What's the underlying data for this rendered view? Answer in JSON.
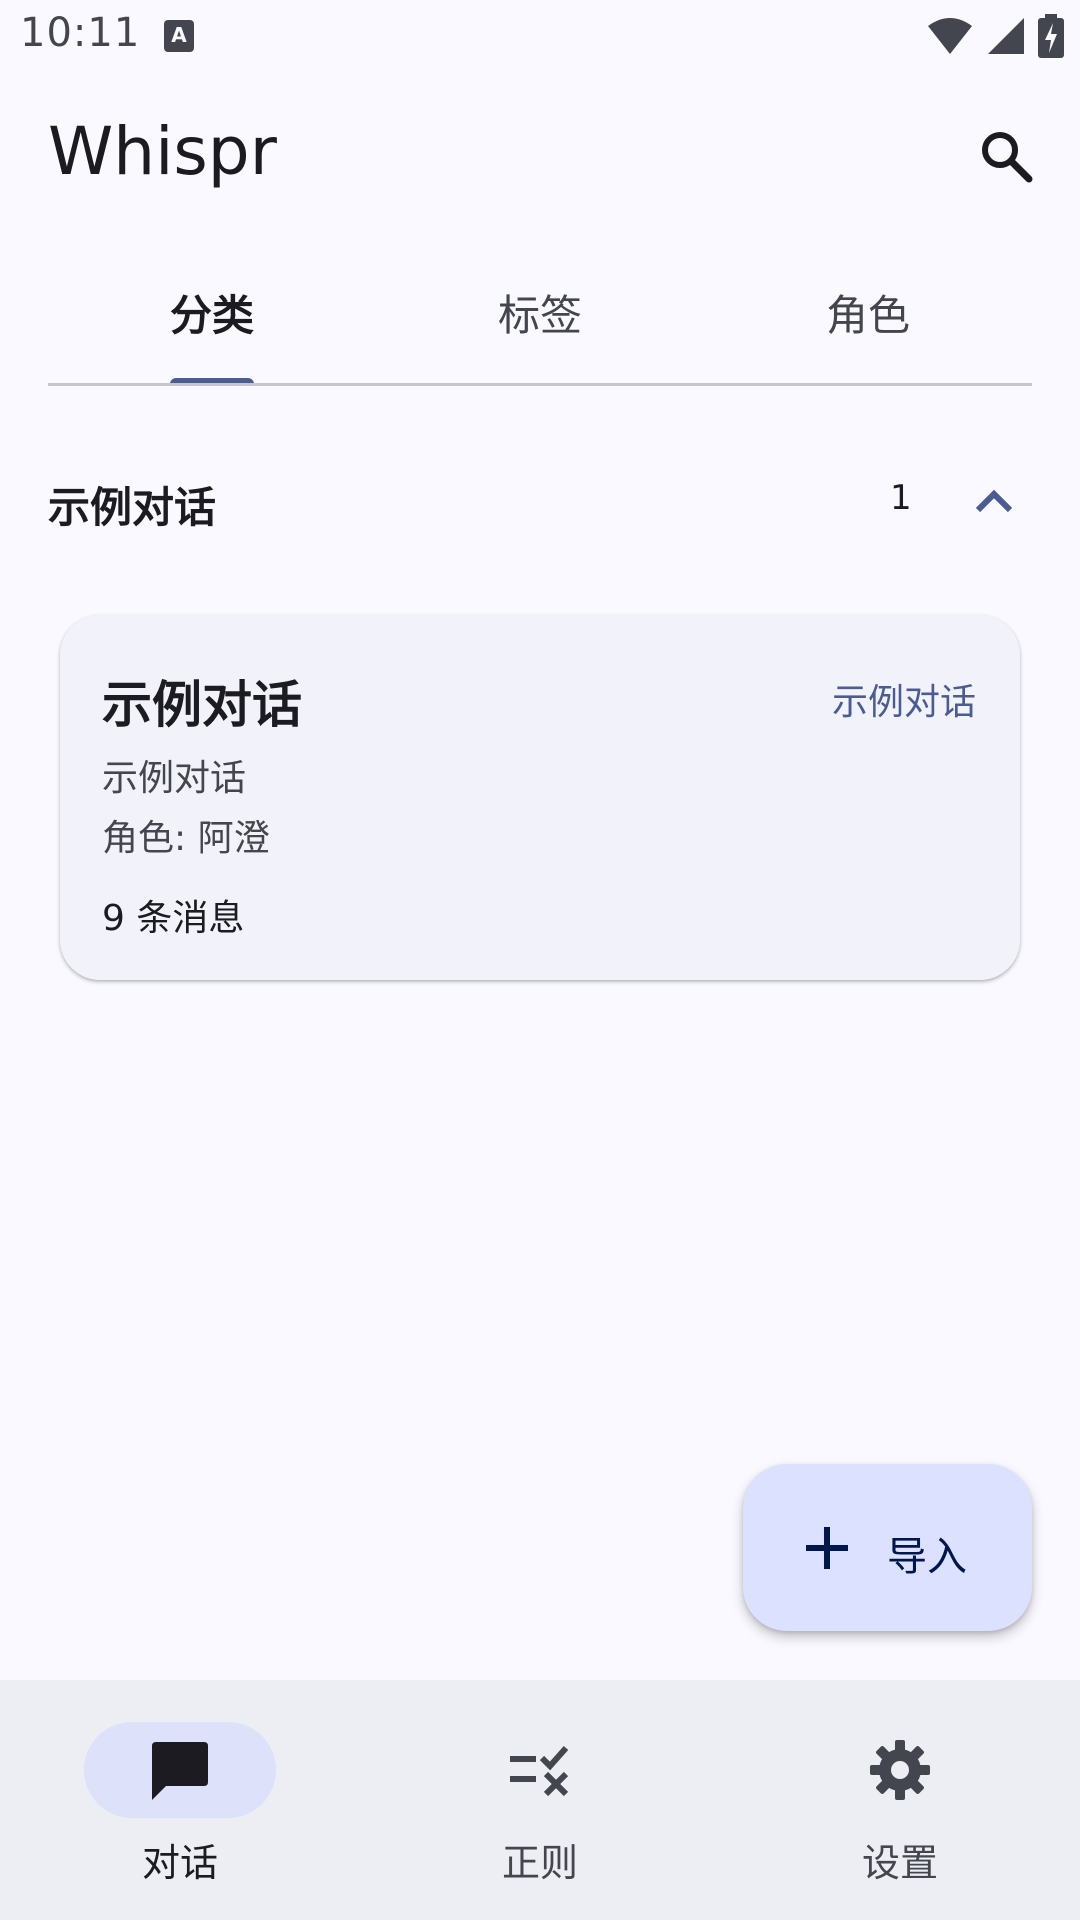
{
  "status_bar": {
    "time": "10:11",
    "notification_icon": "A",
    "icons": [
      "wifi-icon",
      "signal-icon",
      "battery-charging-icon"
    ]
  },
  "app_bar": {
    "title": "Whispr",
    "search_icon": "search-icon"
  },
  "tabs": [
    {
      "label": "分类",
      "active": true
    },
    {
      "label": "标签",
      "active": false
    },
    {
      "label": "角色",
      "active": false
    }
  ],
  "group": {
    "title": "示例对话",
    "count": "1",
    "expanded": true,
    "chevron_icon": "chevron-up-icon"
  },
  "conversations": [
    {
      "title": "示例对话",
      "category": "示例对话",
      "description": "示例对话",
      "character": "角色: 阿澄",
      "messages": "9 条消息"
    }
  ],
  "fab": {
    "icon": "plus-icon",
    "label": "导入"
  },
  "bottom_nav": [
    {
      "label": "对话",
      "icon": "chat-bubble-icon",
      "active": true
    },
    {
      "label": "正则",
      "icon": "regex-check-icon",
      "active": false
    },
    {
      "label": "设置",
      "icon": "gear-icon",
      "active": false
    }
  ],
  "colors": {
    "background": "#f9f9ff",
    "primary": "#4a5c92",
    "card": "#f2f3fa",
    "fab": "#dbe1ff",
    "nav_bar": "#ededf4",
    "nav_active_pill": "#dde1f9"
  }
}
